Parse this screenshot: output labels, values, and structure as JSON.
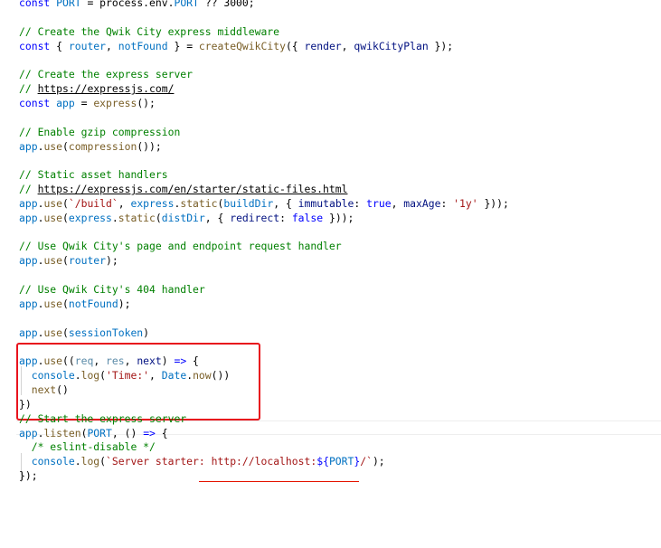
{
  "code_lines": [
    {
      "segments": [
        {
          "t": "const ",
          "c": "c-kw"
        },
        {
          "t": "PORT",
          "c": "c-var"
        },
        {
          "t": " = process.env.",
          "c": "c-plain"
        },
        {
          "t": "PORT",
          "c": "c-var"
        },
        {
          "t": " ?? ",
          "c": "c-plain"
        },
        {
          "t": "3000",
          "c": "c-plain"
        },
        {
          "t": ";",
          "c": "c-plain"
        }
      ]
    },
    {
      "segments": []
    },
    {
      "segments": [
        {
          "t": "// Create the Qwik City express middleware",
          "c": "c-comment"
        }
      ]
    },
    {
      "segments": [
        {
          "t": "const",
          "c": "c-kw"
        },
        {
          "t": " { ",
          "c": "c-plain"
        },
        {
          "t": "router",
          "c": "c-var"
        },
        {
          "t": ", ",
          "c": "c-plain"
        },
        {
          "t": "notFound",
          "c": "c-var"
        },
        {
          "t": " } = ",
          "c": "c-plain"
        },
        {
          "t": "createQwikCity",
          "c": "c-fn"
        },
        {
          "t": "({ ",
          "c": "c-plain"
        },
        {
          "t": "render",
          "c": "c-prop"
        },
        {
          "t": ", ",
          "c": "c-plain"
        },
        {
          "t": "qwikCityPlan",
          "c": "c-prop"
        },
        {
          "t": " });",
          "c": "c-plain"
        }
      ]
    },
    {
      "segments": []
    },
    {
      "segments": [
        {
          "t": "// Create the express server",
          "c": "c-comment"
        }
      ]
    },
    {
      "segments": [
        {
          "t": "// ",
          "c": "c-comment"
        },
        {
          "t": "https://expressjs.com/",
          "c": "c-link"
        }
      ]
    },
    {
      "segments": [
        {
          "t": "const",
          "c": "c-kw"
        },
        {
          "t": " ",
          "c": "c-plain"
        },
        {
          "t": "app",
          "c": "c-var"
        },
        {
          "t": " = ",
          "c": "c-plain"
        },
        {
          "t": "express",
          "c": "c-fn"
        },
        {
          "t": "();",
          "c": "c-plain"
        }
      ]
    },
    {
      "segments": []
    },
    {
      "segments": [
        {
          "t": "// Enable gzip compression",
          "c": "c-comment"
        }
      ]
    },
    {
      "segments": [
        {
          "t": "app",
          "c": "c-var"
        },
        {
          "t": ".",
          "c": "c-plain"
        },
        {
          "t": "use",
          "c": "c-fn"
        },
        {
          "t": "(",
          "c": "c-plain"
        },
        {
          "t": "compression",
          "c": "c-fn"
        },
        {
          "t": "());",
          "c": "c-plain"
        }
      ]
    },
    {
      "segments": []
    },
    {
      "segments": [
        {
          "t": "// Static asset handlers",
          "c": "c-comment"
        }
      ]
    },
    {
      "segments": [
        {
          "t": "// ",
          "c": "c-comment"
        },
        {
          "t": "https://expressjs.com/en/starter/static-files.html",
          "c": "c-link"
        }
      ]
    },
    {
      "segments": [
        {
          "t": "app",
          "c": "c-var"
        },
        {
          "t": ".",
          "c": "c-plain"
        },
        {
          "t": "use",
          "c": "c-fn"
        },
        {
          "t": "(",
          "c": "c-plain"
        },
        {
          "t": "`/build`",
          "c": "c-str"
        },
        {
          "t": ", ",
          "c": "c-plain"
        },
        {
          "t": "express",
          "c": "c-var"
        },
        {
          "t": ".",
          "c": "c-plain"
        },
        {
          "t": "static",
          "c": "c-fn"
        },
        {
          "t": "(",
          "c": "c-plain"
        },
        {
          "t": "buildDir",
          "c": "c-var"
        },
        {
          "t": ", { ",
          "c": "c-plain"
        },
        {
          "t": "immutable",
          "c": "c-prop"
        },
        {
          "t": ": ",
          "c": "c-plain"
        },
        {
          "t": "true",
          "c": "c-kw"
        },
        {
          "t": ", ",
          "c": "c-plain"
        },
        {
          "t": "maxAge",
          "c": "c-prop"
        },
        {
          "t": ": ",
          "c": "c-plain"
        },
        {
          "t": "'1y'",
          "c": "c-str"
        },
        {
          "t": " }));",
          "c": "c-plain"
        }
      ]
    },
    {
      "segments": [
        {
          "t": "app",
          "c": "c-var"
        },
        {
          "t": ".",
          "c": "c-plain"
        },
        {
          "t": "use",
          "c": "c-fn"
        },
        {
          "t": "(",
          "c": "c-plain"
        },
        {
          "t": "express",
          "c": "c-var"
        },
        {
          "t": ".",
          "c": "c-plain"
        },
        {
          "t": "static",
          "c": "c-fn"
        },
        {
          "t": "(",
          "c": "c-plain"
        },
        {
          "t": "distDir",
          "c": "c-var"
        },
        {
          "t": ", { ",
          "c": "c-plain"
        },
        {
          "t": "redirect",
          "c": "c-prop"
        },
        {
          "t": ": ",
          "c": "c-plain"
        },
        {
          "t": "false",
          "c": "c-kw"
        },
        {
          "t": " }));",
          "c": "c-plain"
        }
      ]
    },
    {
      "segments": []
    },
    {
      "segments": [
        {
          "t": "// Use Qwik City's page and endpoint request handler",
          "c": "c-comment"
        }
      ]
    },
    {
      "segments": [
        {
          "t": "app",
          "c": "c-var"
        },
        {
          "t": ".",
          "c": "c-plain"
        },
        {
          "t": "use",
          "c": "c-fn"
        },
        {
          "t": "(",
          "c": "c-plain"
        },
        {
          "t": "router",
          "c": "c-var"
        },
        {
          "t": ");",
          "c": "c-plain"
        }
      ]
    },
    {
      "segments": []
    },
    {
      "segments": [
        {
          "t": "// Use Qwik City's 404 handler",
          "c": "c-comment"
        }
      ]
    },
    {
      "segments": [
        {
          "t": "app",
          "c": "c-var"
        },
        {
          "t": ".",
          "c": "c-plain"
        },
        {
          "t": "use",
          "c": "c-fn"
        },
        {
          "t": "(",
          "c": "c-plain"
        },
        {
          "t": "notFound",
          "c": "c-var"
        },
        {
          "t": ");",
          "c": "c-plain"
        }
      ]
    },
    {
      "segments": []
    },
    {
      "segments": [
        {
          "t": "app",
          "c": "c-var"
        },
        {
          "t": ".",
          "c": "c-plain"
        },
        {
          "t": "use",
          "c": "c-fn"
        },
        {
          "t": "(",
          "c": "c-plain"
        },
        {
          "t": "sessionToken",
          "c": "c-var"
        },
        {
          "t": ")",
          "c": "c-plain"
        }
      ]
    },
    {
      "segments": []
    },
    {
      "segments": [
        {
          "t": "app",
          "c": "c-var"
        },
        {
          "t": ".",
          "c": "c-plain"
        },
        {
          "t": "use",
          "c": "c-fn"
        },
        {
          "t": "((",
          "c": "c-plain"
        },
        {
          "t": "req",
          "c": "c-unused"
        },
        {
          "t": ", ",
          "c": "c-plain"
        },
        {
          "t": "res",
          "c": "c-unused"
        },
        {
          "t": ", ",
          "c": "c-plain"
        },
        {
          "t": "next",
          "c": "c-param"
        },
        {
          "t": ") ",
          "c": "c-plain"
        },
        {
          "t": "=>",
          "c": "c-kw"
        },
        {
          "t": " {",
          "c": "c-plain"
        }
      ]
    },
    {
      "segments": [
        {
          "t": "  ",
          "c": "c-plain"
        },
        {
          "t": "console",
          "c": "c-var"
        },
        {
          "t": ".",
          "c": "c-plain"
        },
        {
          "t": "log",
          "c": "c-fn"
        },
        {
          "t": "(",
          "c": "c-plain"
        },
        {
          "t": "'Time:'",
          "c": "c-str"
        },
        {
          "t": ", ",
          "c": "c-plain"
        },
        {
          "t": "Date",
          "c": "c-var"
        },
        {
          "t": ".",
          "c": "c-plain"
        },
        {
          "t": "now",
          "c": "c-fn"
        },
        {
          "t": "())",
          "c": "c-plain"
        }
      ]
    },
    {
      "segments": [
        {
          "t": "  ",
          "c": "c-plain"
        },
        {
          "t": "next",
          "c": "c-fn"
        },
        {
          "t": "()",
          "c": "c-plain"
        }
      ]
    },
    {
      "segments": [
        {
          "t": "})",
          "c": "c-plain"
        }
      ]
    },
    {
      "segments": [
        {
          "t": "// Start the express server",
          "c": "c-comment"
        }
      ]
    },
    {
      "segments": [
        {
          "t": "app",
          "c": "c-var"
        },
        {
          "t": ".",
          "c": "c-plain"
        },
        {
          "t": "listen",
          "c": "c-fn"
        },
        {
          "t": "(",
          "c": "c-plain"
        },
        {
          "t": "PORT",
          "c": "c-var"
        },
        {
          "t": ", () ",
          "c": "c-plain"
        },
        {
          "t": "=>",
          "c": "c-kw"
        },
        {
          "t": " {",
          "c": "c-plain"
        }
      ]
    },
    {
      "segments": [
        {
          "t": "  ",
          "c": "c-plain"
        },
        {
          "t": "/* eslint-disable */",
          "c": "c-comment"
        }
      ]
    },
    {
      "segments": [
        {
          "t": "  ",
          "c": "c-plain"
        },
        {
          "t": "console",
          "c": "c-var"
        },
        {
          "t": ".",
          "c": "c-plain"
        },
        {
          "t": "log",
          "c": "c-fn"
        },
        {
          "t": "(",
          "c": "c-plain"
        },
        {
          "t": "`Server starter: ",
          "c": "c-str"
        },
        {
          "t": "http://localhost:",
          "c": "c-str"
        },
        {
          "t": "${",
          "c": "c-kw"
        },
        {
          "t": "PORT",
          "c": "c-var"
        },
        {
          "t": "}",
          "c": "c-kw"
        },
        {
          "t": "/`",
          "c": "c-str"
        },
        {
          "t": ");",
          "c": "c-plain"
        }
      ]
    },
    {
      "segments": [
        {
          "t": "});",
          "c": "c-plain"
        }
      ]
    }
  ]
}
